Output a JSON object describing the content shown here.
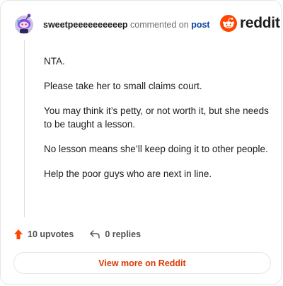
{
  "header": {
    "username": "sweetpeeeeeeeeeep",
    "commented_text": "commented on",
    "post_link": "post"
  },
  "logo": {
    "text": "reddit",
    "icon": "reddit-snoo-icon",
    "color": "#ff4500"
  },
  "comment": {
    "paragraphs": [
      "NTA.",
      "Please take her to small claims court.",
      "You may think it’s petty, or not worth it, but she needs to be taught a lesson.",
      "No lesson means she’ll keep doing it to other people.",
      "Help the poor guys who are next in line."
    ]
  },
  "footer": {
    "upvotes": "10 upvotes",
    "upvote_icon": "upvote-arrow-icon",
    "replies": "0 replies",
    "reply_icon": "reply-arrow-icon"
  },
  "view_more": {
    "label": "View more on Reddit",
    "color": "#d93a00"
  }
}
